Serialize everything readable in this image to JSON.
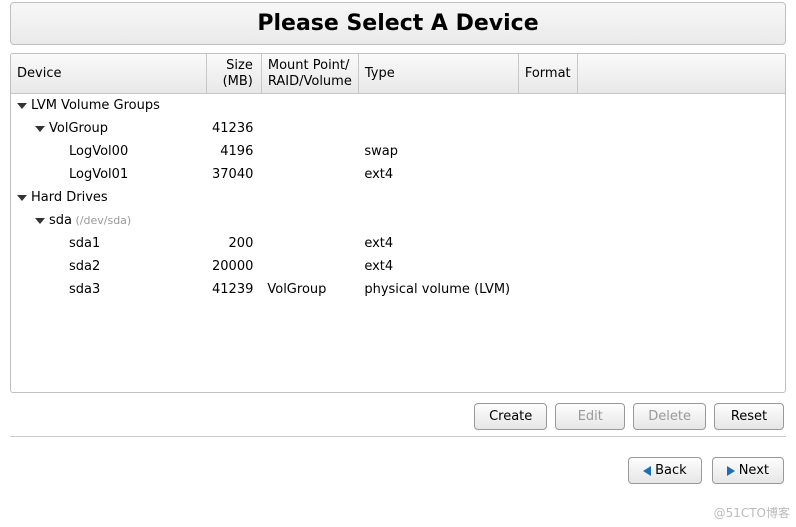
{
  "title": "Please Select A Device",
  "columns": {
    "device": "Device",
    "size": "Size\n(MB)",
    "mount": "Mount Point/\nRAID/Volume",
    "type": "Type",
    "format": "Format"
  },
  "rows": [
    {
      "level": 0,
      "expander": true,
      "device": "LVM Volume Groups",
      "size": "",
      "mount": "",
      "type": "",
      "format": ""
    },
    {
      "level": 1,
      "expander": true,
      "device": "VolGroup",
      "size": "41236",
      "mount": "",
      "type": "",
      "format": ""
    },
    {
      "level": 2,
      "expander": false,
      "device": "LogVol00",
      "size": "4196",
      "mount": "",
      "type": "swap",
      "format": ""
    },
    {
      "level": 2,
      "expander": false,
      "device": "LogVol01",
      "size": "37040",
      "mount": "",
      "type": "ext4",
      "format": ""
    },
    {
      "level": 0,
      "expander": true,
      "device": "Hard Drives",
      "size": "",
      "mount": "",
      "type": "",
      "format": ""
    },
    {
      "level": 1,
      "expander": true,
      "device": "sda",
      "path": "(/dev/sda)",
      "size": "",
      "mount": "",
      "type": "",
      "format": ""
    },
    {
      "level": 2,
      "expander": false,
      "device": "sda1",
      "size": "200",
      "mount": "",
      "type": "ext4",
      "format": ""
    },
    {
      "level": 2,
      "expander": false,
      "device": "sda2",
      "size": "20000",
      "mount": "",
      "type": "ext4",
      "format": ""
    },
    {
      "level": 2,
      "expander": false,
      "device": "sda3",
      "size": "41239",
      "mount": "VolGroup",
      "type": "physical volume (LVM)",
      "format": ""
    }
  ],
  "buttons": {
    "create": "Create",
    "edit": "Edit",
    "delete": "Delete",
    "reset": "Reset",
    "back": "Back",
    "next": "Next"
  },
  "watermark": "@51CTO博客"
}
